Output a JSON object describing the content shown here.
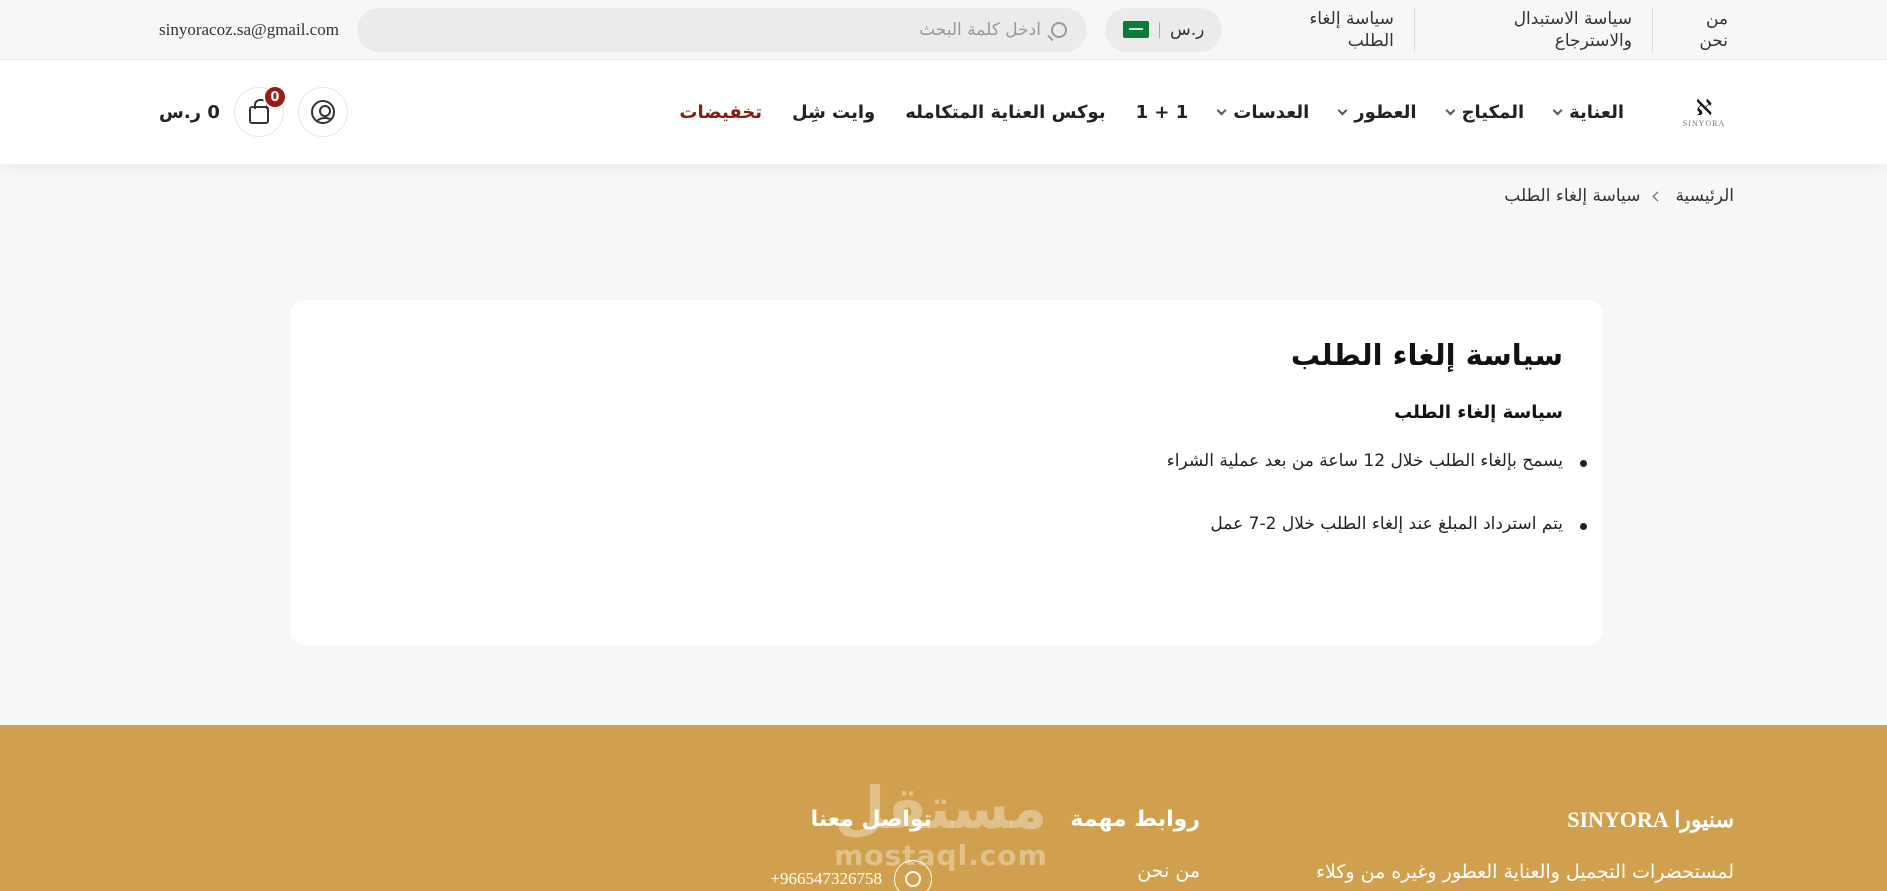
{
  "topbar": {
    "links": [
      "من نحن",
      "سياسة الاستبدال والاسترجاع",
      "سياسة إلغاء الطلب"
    ],
    "currency": "ر.س",
    "search_placeholder": "ادخل كلمة البحث",
    "email": "sinyoracoz.sa@gmail.com"
  },
  "header": {
    "logo_word": "SINYORA",
    "nav": [
      {
        "label": "العناية",
        "dropdown": true
      },
      {
        "label": "المكياج",
        "dropdown": true
      },
      {
        "label": "العطور",
        "dropdown": true
      },
      {
        "label": "العدسات",
        "dropdown": true
      },
      {
        "label": "1 + 1",
        "dropdown": false
      },
      {
        "label": "بوكس العناية المتكامله",
        "dropdown": false
      },
      {
        "label": "وايت شِل",
        "dropdown": false
      },
      {
        "label": "تخفيضات",
        "dropdown": false
      }
    ],
    "cart_count": "0",
    "cart_total": "0 ر.س"
  },
  "breadcrumb": {
    "home": "الرئيسية",
    "current": "سياسة إلغاء الطلب"
  },
  "content": {
    "title": "سياسة إلغاء الطلب",
    "subtitle": "سياسة إلغاء الطلب",
    "points": [
      "يسمح بإلغاء الطلب خلال 12 ساعة من بعد عملية الشراء",
      "يتم استرداد المبلغ عند إلغاء الطلب خلال 2-7 عمل"
    ]
  },
  "footer": {
    "brand_title": "سنيورا SINYORA",
    "brand_text": "لمستحضرات التجميل والعناية العطور وغيره من وكلاء",
    "links_title": "روابط مهمة",
    "links_first": "من نحن",
    "contact_title": "تواصل معنا",
    "phone": "+966547326758",
    "watermark_ar": "مستقل",
    "watermark_lat": "mostaql.com"
  },
  "colors": {
    "accent_footer": "#d1a04e",
    "sale": "#8b1a13",
    "badge": "#9b1c14"
  }
}
